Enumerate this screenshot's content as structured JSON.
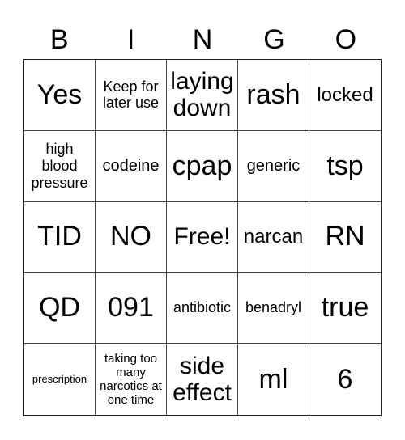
{
  "header": [
    "B",
    "I",
    "N",
    "G",
    "O"
  ],
  "cells": [
    {
      "text": "Yes",
      "size": "s-xl"
    },
    {
      "text": "Keep for later use",
      "size": "s-s"
    },
    {
      "text": "laying down",
      "size": "s-l"
    },
    {
      "text": "rash",
      "size": "s-xl"
    },
    {
      "text": "locked",
      "size": "s-m"
    },
    {
      "text": "high blood pressure",
      "size": "s-s"
    },
    {
      "text": "codeine",
      "size": "s-sm"
    },
    {
      "text": "cpap",
      "size": "s-xl"
    },
    {
      "text": "generic",
      "size": "s-sm"
    },
    {
      "text": "tsp",
      "size": "s-xl"
    },
    {
      "text": "TID",
      "size": "s-xl"
    },
    {
      "text": "NO",
      "size": "s-xl"
    },
    {
      "text": "Free!",
      "size": "s-l"
    },
    {
      "text": "narcan",
      "size": "s-m"
    },
    {
      "text": "RN",
      "size": "s-xl"
    },
    {
      "text": "QD",
      "size": "s-xl"
    },
    {
      "text": "091",
      "size": "s-xl"
    },
    {
      "text": "antibiotic",
      "size": "s-s"
    },
    {
      "text": "benadryl",
      "size": "s-s"
    },
    {
      "text": "true",
      "size": "s-xl"
    },
    {
      "text": "prescription",
      "size": "s-xxs"
    },
    {
      "text": "taking too many narcotics at one time",
      "size": "s-xs"
    },
    {
      "text": "side effect",
      "size": "s-l"
    },
    {
      "text": "ml",
      "size": "s-xl"
    },
    {
      "text": "6",
      "size": "s-xl"
    }
  ]
}
